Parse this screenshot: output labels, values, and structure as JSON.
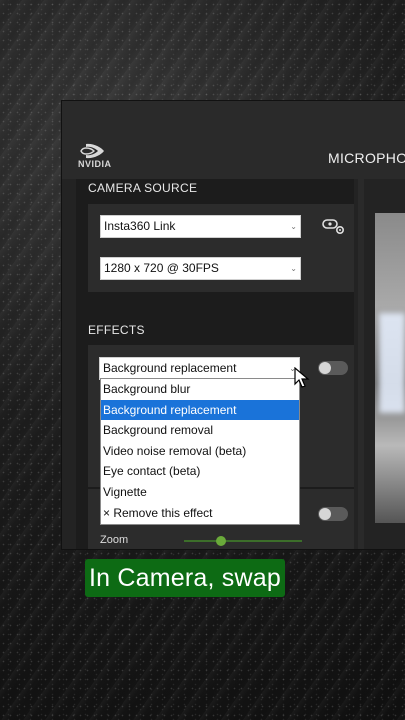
{
  "app": {
    "logo_text": "NVIDIA",
    "tab_microphone": "MICROPHO"
  },
  "camera_source": {
    "section_title": "CAMERA SOURCE",
    "device": "Insta360 Link",
    "resolution": "1280 x 720 @ 30FPS"
  },
  "effects": {
    "section_title": "EFFECTS",
    "selected": "Background replacement",
    "options": [
      "Background blur",
      "Background replacement",
      "Background removal",
      "Video noise removal (beta)",
      "Eye contact (beta)",
      "Vignette",
      "× Remove this effect"
    ],
    "highlighted_index": 1,
    "zoom_label": "Zoom",
    "zoom_value": 0.3
  },
  "caption": "In Camera, swap",
  "colors": {
    "accent_green": "#76b900",
    "selection_blue": "#1a73d9",
    "caption_bg": "#0d6b14"
  }
}
